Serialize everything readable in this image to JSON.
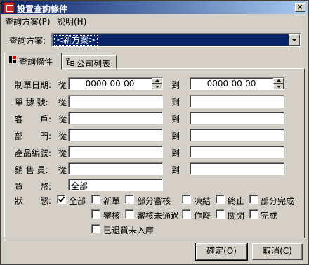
{
  "window": {
    "title": "設置查詢條件",
    "close_glyph": "×"
  },
  "menu": [
    {
      "label": "查詢方案(P)"
    },
    {
      "label": "說明(H)"
    }
  ],
  "scheme": {
    "label": "查詢方案:",
    "value": "<新方案>"
  },
  "tabs": [
    {
      "label": "查詢條件",
      "icon": "filter-icon"
    },
    {
      "label": "公司列表",
      "icon": "company-tree-icon"
    }
  ],
  "rows": [
    {
      "label": "制單日期:",
      "from": "從",
      "from_value": "0000-00-00",
      "to": "到",
      "to_value": "0000-00-00"
    },
    {
      "label": "單 據 號:",
      "from": "從",
      "from_value": "",
      "to": "到",
      "to_value": ""
    },
    {
      "label": "客　　戶:",
      "from": "從",
      "from_value": "",
      "to": "到",
      "to_value": ""
    },
    {
      "label": "部　　門:",
      "from": "從",
      "from_value": "",
      "to": "到",
      "to_value": ""
    },
    {
      "label": "產品編號:",
      "from": "從",
      "from_value": "",
      "to": "到",
      "to_value": ""
    },
    {
      "label": "銷 售 員:",
      "from": "從",
      "from_value": "",
      "to": "到",
      "to_value": ""
    }
  ],
  "currency": {
    "label": "貨　　幣:",
    "value": "全部"
  },
  "status": {
    "label": "狀　　態:",
    "options": [
      {
        "label": "全部",
        "checked": true
      },
      {
        "label": "新單",
        "checked": false
      },
      {
        "label": "部分審核",
        "checked": false
      },
      {
        "label": "凍結",
        "checked": false
      },
      {
        "label": "終止",
        "checked": false
      },
      {
        "label": "部分完成",
        "checked": false
      },
      {
        "label": "審核",
        "checked": false
      },
      {
        "label": "審核未通過",
        "checked": false
      },
      {
        "label": "作廢",
        "checked": false
      },
      {
        "label": "關閉",
        "checked": false
      },
      {
        "label": "完成",
        "checked": false
      },
      {
        "label": "已退貨未入庫",
        "checked": false
      }
    ]
  },
  "buttons": {
    "ok": "確定(O)",
    "cancel": "取消(C)"
  }
}
